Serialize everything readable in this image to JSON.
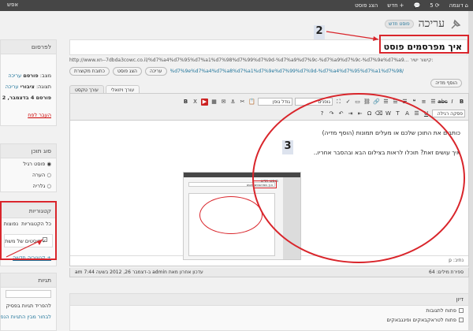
{
  "adminbar": {
    "site": "דוגמה",
    "updates": "5",
    "comments_icon": "comment-icon",
    "new_label": "חדש",
    "view_post": "הצג פוסט",
    "left_item": "אפש"
  },
  "page": {
    "title": "עריכה",
    "add_new": "פוסט חדש",
    "post_title": "איך מפרסמים פוסט",
    "permalink_label": "קישור ישיר:",
    "permalink_url": "http://www.xn--7dbda3cowc.co.il/%d7%a4%d7%95%d7%a1%d7%98%d7%99%d7%9d-%d7%a9%d7%9c-%d7%a9%d7%9c-%d7%9e%d7%a9...",
    "slug": "%d7%9e%d7%a4%d7%a8%d7%a1%d7%9e%d7%99%d7%9d-%d7%a4%d7%95%d7%a1%d7%98/",
    "edit_btn": "עריכה",
    "view_btn": "הצג פוסט",
    "shortlink_btn": "כתובת מקוצרת"
  },
  "editor": {
    "add_media": "הוסף מדיה",
    "tab_visual": "עורך ויזואלי",
    "tab_text": "עורך טקסט",
    "font_family": "גופנים",
    "font_size": "גודל גופן",
    "paragraph": "פסקה רגילה",
    "content_line1": "כותבים את התוכן שלכם או מעלים תמונות (הוסף מדיה)",
    "content_line2": "איך עושים זאת? תוכלו לראות בצילום הבא ובהסבר אחריו..",
    "path": "נתיב: p",
    "word_count": "ספירת מילים: 64",
    "last_edit": "עדכון אחרון מאת admin ב-דצמבר 26, 2012 בשעה 7:44 am",
    "inner_title": "פוסט חדש",
    "inner_post": "איך מפרסמים פוסט"
  },
  "callouts": [
    "2",
    "3"
  ],
  "publish": {
    "heading": "לפרסום",
    "status_label": "מצב:",
    "status_value": "פורסם",
    "status_edit": "עריכה",
    "visibility_label": "תצוגה:",
    "visibility_value": "ציבורי",
    "visibility_edit": "עריכה",
    "published_on": "פורסם 4 בדצמבר, 2",
    "trash": "העבר לפח"
  },
  "format": {
    "heading": "סוג תוכן",
    "options": [
      "פוסט רגיל",
      "הערה",
      "גלריה"
    ]
  },
  "categories": {
    "heading": "קטגוריות",
    "tab_all": "כל הקטגוריות",
    "tab_popular": "נפוצות",
    "item": "פוסטים של משתמשים",
    "add_new": "+ קטגוריה חדשה"
  },
  "tags": {
    "heading": "תגיות",
    "hint": "להפריד תגיות בפסיק",
    "choose": "לבחור מבין התגיות הנפוצ"
  },
  "discussion": {
    "heading": "דיון",
    "allow_comments": "פתוח לתגובות",
    "allow_pings": "פתוח לטראקבאקים ופינגבאקים"
  }
}
